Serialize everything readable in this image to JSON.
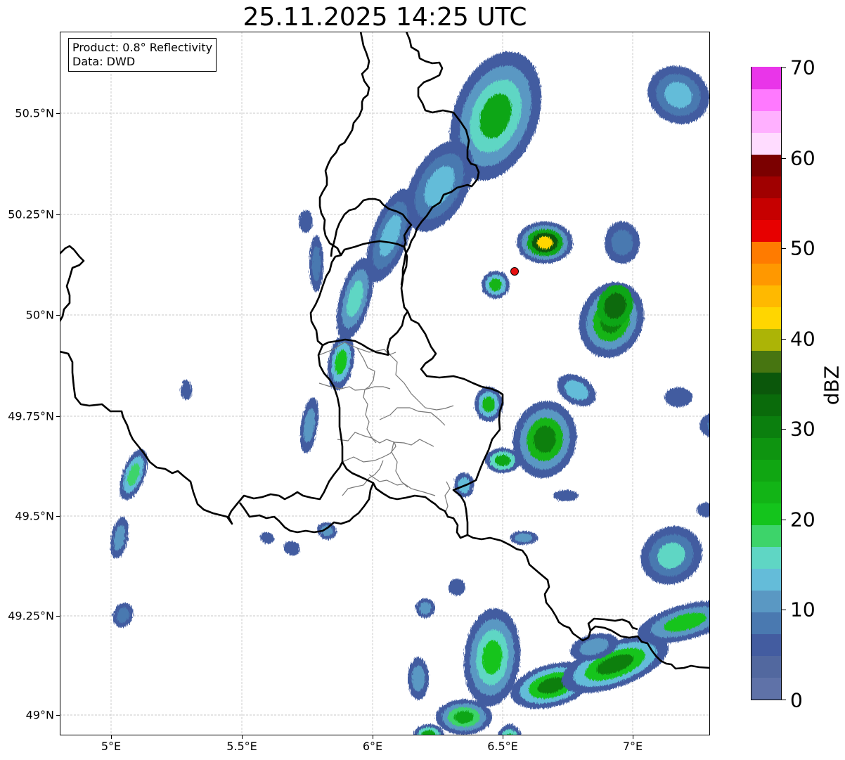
{
  "title": "25.11.2025 14:25 UTC",
  "info": {
    "product": "Product: 0.8° Reflectivity",
    "source": "Data: DWD"
  },
  "axes": {
    "lon_ticks": [
      "5°E",
      "5.5°E",
      "6°E",
      "6.5°E",
      "7°E"
    ],
    "lat_ticks": [
      "50.5°N",
      "50.25°N",
      "50°N",
      "49.75°N",
      "49.5°N",
      "49.25°N",
      "49°N"
    ]
  },
  "colorbar": {
    "unit": "dBZ",
    "ticks": [
      "70",
      "60",
      "50",
      "40",
      "30",
      "20",
      "10",
      "0"
    ],
    "colors": [
      "#5f72a8",
      "#52689f",
      "#435ca0",
      "#4a79b0",
      "#5a98c3",
      "#64bcd9",
      "#5fd6c4",
      "#3dd46a",
      "#14c41c",
      "#12b416",
      "#10a612",
      "#0e9410",
      "#0b7f0e",
      "#0a6b0b",
      "#0b570b",
      "#477511",
      "#acb406",
      "#ffd600",
      "#ffb900",
      "#ff9800",
      "#ff7b00",
      "#e70000",
      "#c60000",
      "#a00000",
      "#7b0000",
      "#ffdcff",
      "#ffb0ff",
      "#ff79ff",
      "#e935e9"
    ]
  },
  "map": {
    "colors": {
      "border": "#000000",
      "district": "#777777",
      "grid": "#b8b8b8",
      "radar_site": "#e81010"
    }
  }
}
